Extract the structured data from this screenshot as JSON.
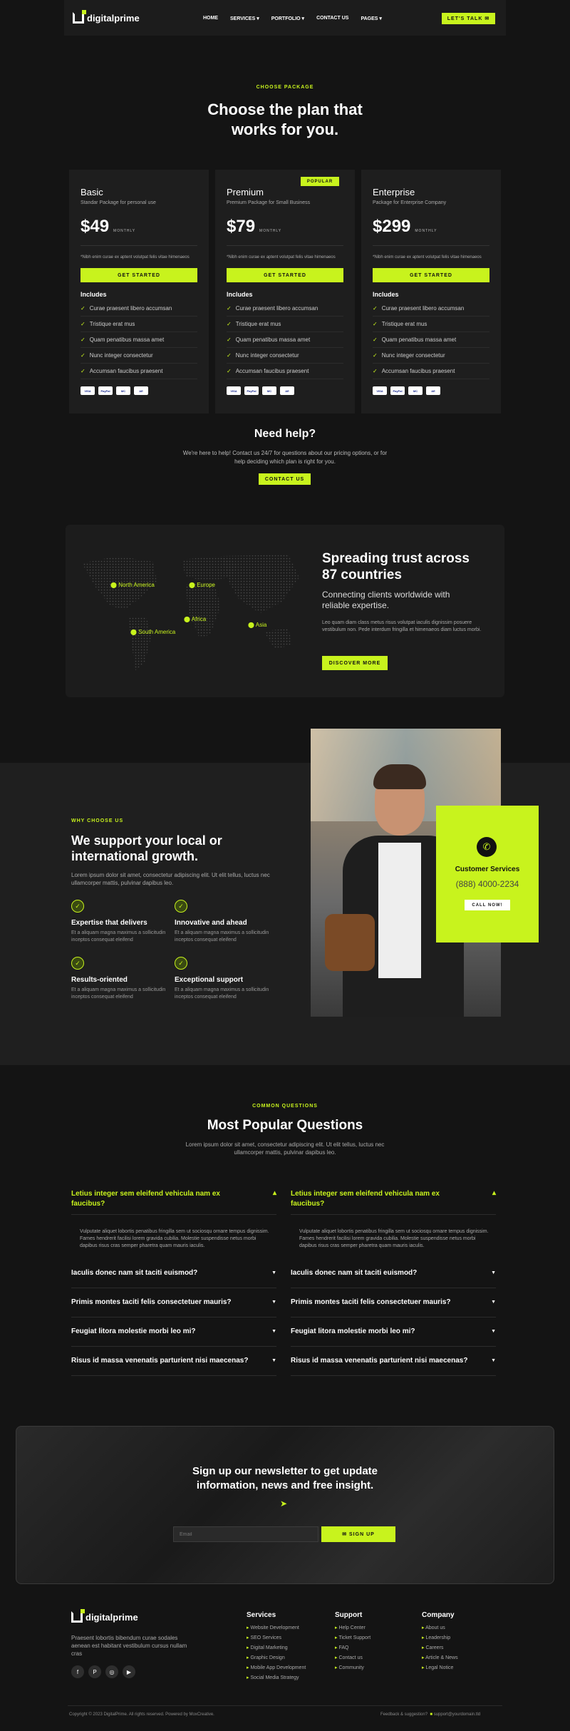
{
  "header": {
    "logo_text": "digitalprime",
    "nav": [
      "HOME",
      "SERVICES",
      "PORTFOLIO",
      "CONTACT US",
      "PAGES"
    ],
    "cta": "LET'S TALK"
  },
  "pricing": {
    "eyebrow": "CHOOSE PACKAGE",
    "title_line1": "Choose the plan that",
    "title_line2": "works for you.",
    "popular_badge": "POPULAR",
    "plans": [
      {
        "name": "Basic",
        "subtitle": "Standar Package for personal use",
        "price": "$49",
        "period": "MONTHLY"
      },
      {
        "name": "Premium",
        "subtitle": "Premium Package for Small Business",
        "price": "$79",
        "period": "MONTHLY"
      },
      {
        "name": "Enterprise",
        "subtitle": "Package for Enterprise Company",
        "price": "$299",
        "period": "MONTHLY"
      }
    ],
    "note": "*Nibh enim curae ex aptent volutpat felis vitae himenaeos",
    "button": "GET STARTED",
    "includes": "Includes",
    "features": [
      "Curae praesent libero accumsan",
      "Tristique erat mus",
      "Quam penatibus massa amet",
      "Nunc integer consectetur",
      "Accumsan faucibus praesent"
    ],
    "payment_cards": [
      "VISA",
      "PayPal",
      "MC",
      "AE"
    ]
  },
  "help": {
    "title": "Need help?",
    "text_line1": "We're here to help! Contact us 24/7 for questions about our pricing options, or for",
    "text_line2": "help deciding which plan is right for you.",
    "button": "CONTACT US"
  },
  "trust": {
    "title_line1": "Spreading trust across",
    "title_line2": "87 countries",
    "subtitle_line1": "Connecting clients worldwide with",
    "subtitle_line2": "reliable expertise.",
    "text": "Leo quam diam class metus risus volutpat iaculis dignissim posuere vestibulum non. Pede interdum fringilla et himenaeos diam luctus morbi.",
    "button": "DISCOVER MORE",
    "regions": [
      "North America",
      "Europe",
      "Africa",
      "South America",
      "Asia"
    ]
  },
  "why": {
    "eyebrow": "WHY CHOOSE US",
    "title_line1": "We support your local or",
    "title_line2": "international growth.",
    "text": "Lorem ipsum dolor sit amet, consectetur adipiscing elit. Ut elit tellus, luctus nec ullamcorper mattis, pulvinar dapibus leo.",
    "features": [
      {
        "title": "Expertise that delivers",
        "text": "Et a aliquam magna maximus a sollicitudin inceptos consequat eleifend"
      },
      {
        "title": "Innovative and ahead",
        "text": "Et a aliquam magna maximus a sollicitudin inceptos consequat eleifend"
      },
      {
        "title": "Results-oriented",
        "text": "Et a aliquam magna maximus a sollicitudin inceptos consequat eleifend"
      },
      {
        "title": "Exceptional support",
        "text": "Et a aliquam magna maximus a sollicitudin inceptos consequat eleifend"
      }
    ],
    "service_card": {
      "title": "Customer Services",
      "phone": "(888) 4000-2234",
      "button": "CALL NOW!"
    }
  },
  "faq": {
    "eyebrow": "COMMON QUESTIONS",
    "title": "Most Popular Questions",
    "text_line1": "Lorem ipsum dolor sit amet, consectetur adipiscing elit. Ut elit tellus, luctus nec",
    "text_line2": "ullamcorper mattis, pulvinar dapibus leo.",
    "open_question": "Letius integer sem eleifend vehicula nam ex faucibus?",
    "answer": "Vulputate aliquet lobortis penatibus fringilla sem ut sociosqu ornare tempus dignissim. Fames hendrerit facilisi lorem gravida cubilia. Molestie suspendisse netus morbi dapibus risus cras semper pharetra quam mauris iaculis.",
    "questions": [
      "Iaculis donec nam sit taciti euismod?",
      "Primis montes taciti felis consectetuer mauris?",
      "Feugiat litora molestie morbi leo mi?",
      "Risus id massa venenatis parturient nisi maecenas?"
    ]
  },
  "newsletter": {
    "title_line1": "Sign up our newsletter to get update",
    "title_line2": "information, news and free insight.",
    "placeholder": "Email",
    "button": "SIGN UP"
  },
  "footer": {
    "logo_text": "digitalprime",
    "about": "Praesent lobortis bibendum curae sodales aenean est habitant vestibulum cursus nullam cras",
    "services_title": "Services",
    "services": [
      "Website Development",
      "SEO Services",
      "Digital Marketing",
      "Graphic Design",
      "Mobile App Development",
      "Social Media Strategy"
    ],
    "support_title": "Support",
    "support": [
      "Help Center",
      "Ticket Support",
      "FAQ",
      "Contact us",
      "Community"
    ],
    "company_title": "Company",
    "company": [
      "About us",
      "Leadership",
      "Careers",
      "Article & News",
      "Legal Notice"
    ],
    "copyright": "Copyright © 2023 DigitalPrime. All rights reserved. Powered by MoxCreative.",
    "feedback": "Feedback & suggestion?",
    "email": "support@yourdomain.tld"
  },
  "colors": {
    "accent": "#c8f31d",
    "background": "#141414",
    "card": "#1e1e1e"
  }
}
